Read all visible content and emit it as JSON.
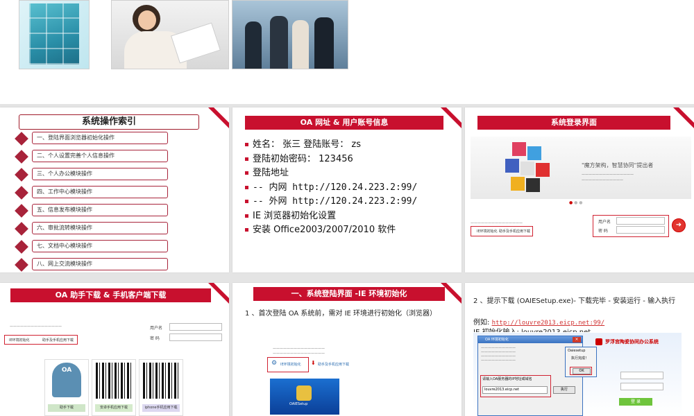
{
  "slides": {
    "index": {
      "title": "系统操作索引",
      "items": [
        "一、登陆界面浏览器初始化操作",
        "二、个人设置完善个人信息操作",
        "三、个人办公模块操作",
        "四、工作中心模块操作",
        "五、信息发布模块操作",
        "六、审批流转模块操作",
        "七、文档中心模块操作",
        "八、网上交流模块操作"
      ]
    },
    "account": {
      "title": "OA 网址 & 用户账号信息",
      "lines": [
        "姓名： 张三  登陆账号： zs",
        "登陆初始密码： 123456",
        "登陆地址",
        "-- 内网 http://120.24.223.2:99/",
        "-- 外网 http://120.24.223.2:99/",
        "IE 浏览器初始化设置",
        "安装 Office2003/2007/2010 软件"
      ]
    },
    "login": {
      "title": "系统登录界面",
      "slogan": "\"魔方架构，智慧协同\"提出者",
      "user_label": "用户名",
      "pass_label": "密 码",
      "links": [
        "IE环境初始化",
        "助手及手机应用下载"
      ]
    },
    "mobile": {
      "title": "OA 助手下载 & 手机客户端下载",
      "user_label": "用户名",
      "pass_label": "密 码",
      "links": [
        "IE环境初始化",
        "助手及手机应用下载"
      ],
      "app_label": "OA",
      "buttons": [
        "助手下载",
        "安卓手机应用下载",
        "iphone手机应用下载"
      ]
    },
    "ieinit": {
      "title": "一、系统登陆界面 -IE 环境初始化",
      "text": "1 、首次登陆 OA 系统前，需对 IE 环境进行初始化（浏览器）",
      "links": [
        "IE环境初始化",
        "助手及手机应用下载"
      ],
      "desktop_label": "OAIESetup"
    },
    "download": {
      "text": "2 、提示下载 (OAIESetup.exe)- 下载完毕 - 安装运行 - 输入执行",
      "example_label": "例如: ",
      "example_url": "http://louvre2013.eicp.net:99/",
      "partial": "IE 初始化输入: louvre2013.eicp.net",
      "dialog_title": "OA 环境初始化",
      "dialog_prompt": "请输入OA服务器的IP地址或域名",
      "dialog_value": "louvre2013.eicp.net",
      "dialog_exec": "执行",
      "popup_title": "Oaiesetup",
      "popup_msg": "执行完成！",
      "popup_ok": "OK",
      "banner": "罗浮宫陶瓷协同办公系统",
      "login_btn": "登 录"
    }
  },
  "colors": {
    "accent": "#c8102e",
    "text": "#222222"
  }
}
